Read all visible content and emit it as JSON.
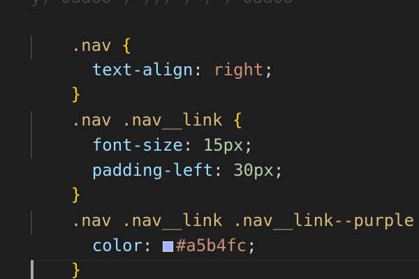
{
  "colors": {
    "background": "#1e1e1e",
    "selector": "#d7ba7d",
    "brace": "#ffd700",
    "property": "#9cdcfe",
    "string_value": "#ce9178",
    "number_value": "#b5cea8",
    "swatch": "#a5b4fc"
  },
  "editor": {
    "clipped_top": "y) oaaoo ) ))) ) ) ) oaaoo",
    "blocks": [
      {
        "selector": ".nav",
        "open": "{",
        "close": "}",
        "declarations": [
          {
            "property": "text-align",
            "colon": ":",
            "value": "right",
            "semi": ";"
          }
        ]
      },
      {
        "selector": ".nav .nav__link",
        "open": "{",
        "close": "}",
        "declarations": [
          {
            "property": "font-size",
            "colon": ":",
            "value": "15px",
            "semi": ";"
          },
          {
            "property": "padding-left",
            "colon": ":",
            "value": "30px",
            "semi": ";"
          }
        ]
      },
      {
        "selector": ".nav .nav__link .nav__link--purple",
        "open": "{",
        "close": "}",
        "declarations": [
          {
            "property": "color",
            "colon": ":",
            "value": "#a5b4fc",
            "semi": ";"
          }
        ]
      }
    ]
  }
}
